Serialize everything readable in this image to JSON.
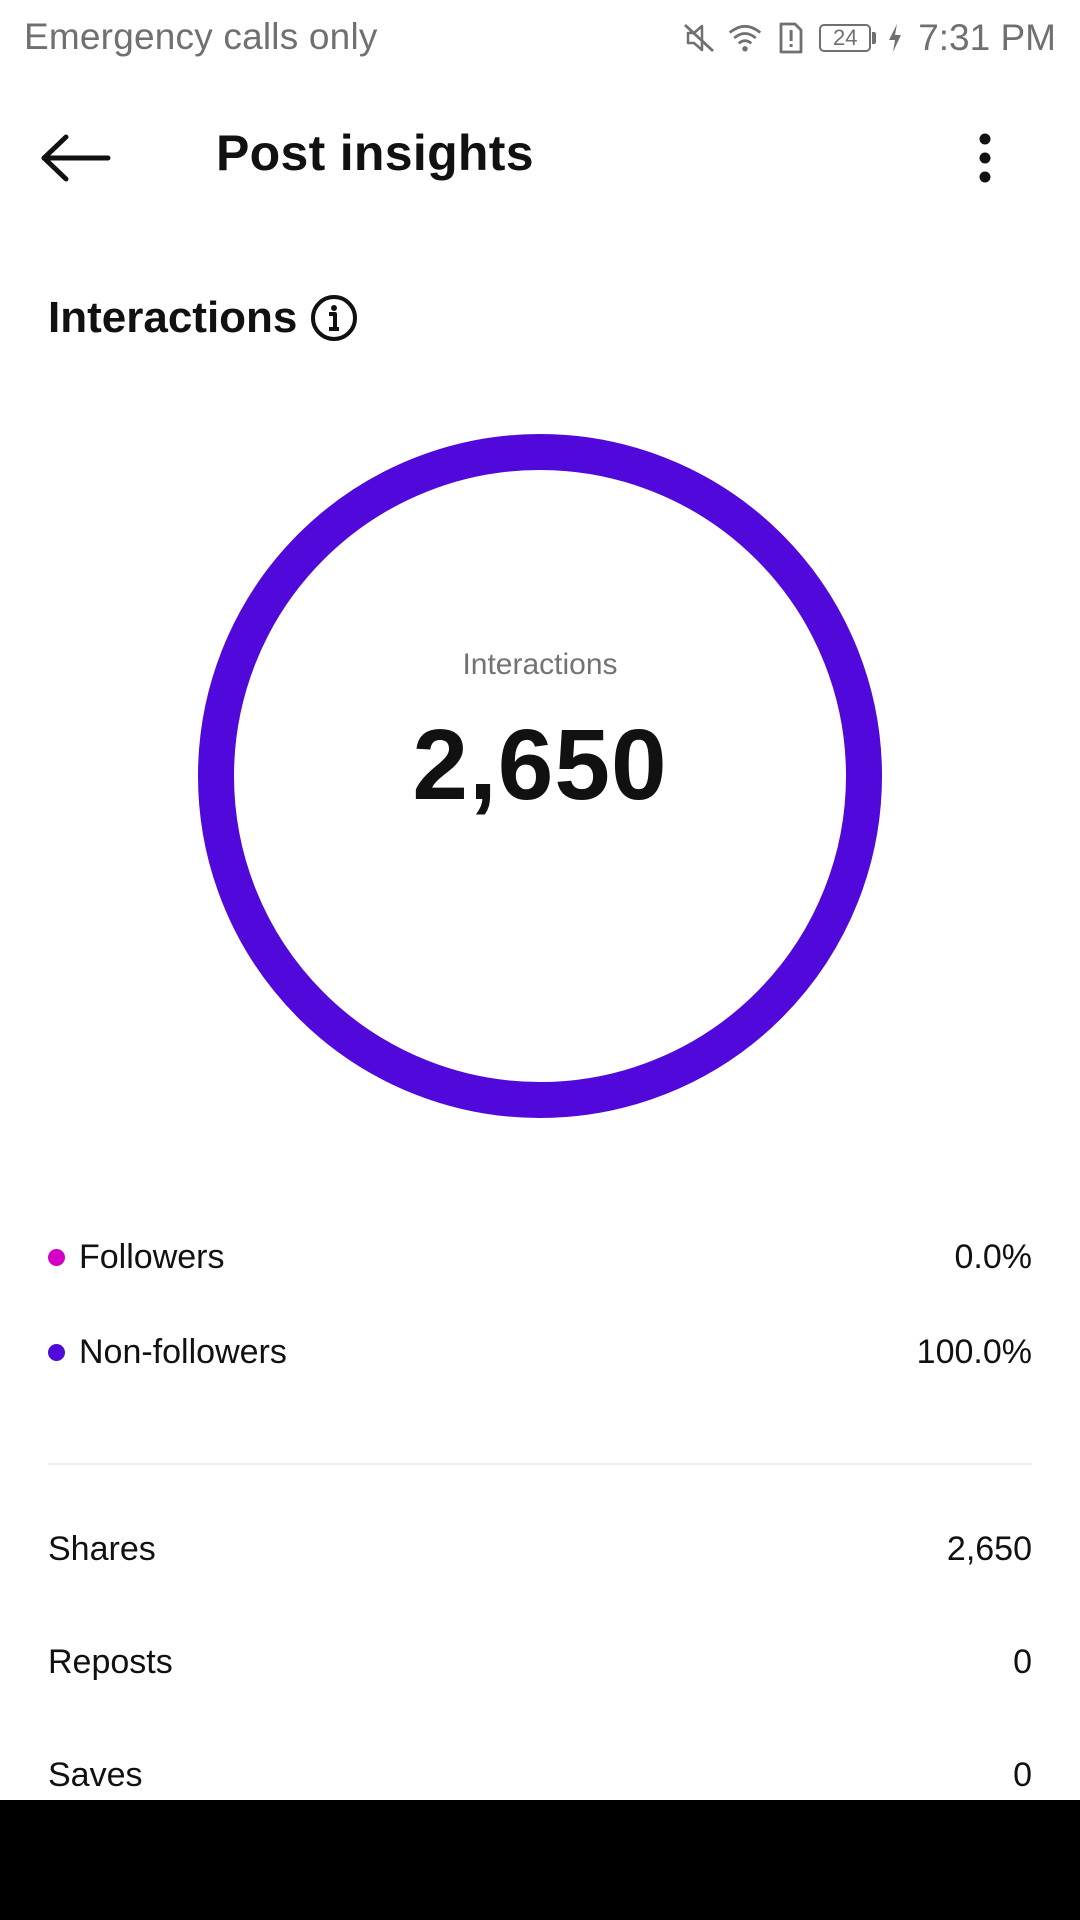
{
  "status_bar": {
    "carrier_text": "Emergency calls only",
    "battery_level": "24",
    "time": "7:31 PM",
    "icons": [
      "mute-icon",
      "wifi-icon",
      "sim-alert-icon",
      "battery-icon",
      "charging-icon"
    ]
  },
  "header": {
    "title": "Post insights",
    "back_icon": "arrow-left-icon",
    "more_icon": "more-vertical-icon"
  },
  "interactions": {
    "section_title": "Interactions",
    "info_icon": "info-icon",
    "donut": {
      "center_label": "Interactions",
      "center_value": "2,650"
    },
    "legend": [
      {
        "label": "Followers",
        "value": "0.0%",
        "color": "#d300c5",
        "fraction": 0.0
      },
      {
        "label": "Non-followers",
        "value": "100.0%",
        "color": "#5108db",
        "fraction": 1.0
      }
    ]
  },
  "metrics": [
    {
      "label": "Shares",
      "value": "2,650"
    },
    {
      "label": "Reposts",
      "value": "0"
    },
    {
      "label": "Saves",
      "value": "0"
    }
  ],
  "colors": {
    "accent": "#5108db",
    "followers": "#d300c5"
  }
}
